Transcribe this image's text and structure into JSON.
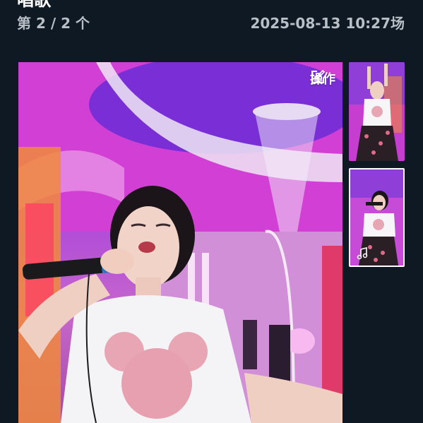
{
  "header": {
    "title": "唱歌",
    "counter": "第 2 / 2 个",
    "datetime": "2025-08-13 10:27场"
  },
  "media": {
    "action_label": "操作",
    "action_icon": "edit-icon",
    "thumbnails": [
      {
        "icon": "none"
      },
      {
        "icon": "music-note-icon",
        "selected": true
      }
    ]
  }
}
